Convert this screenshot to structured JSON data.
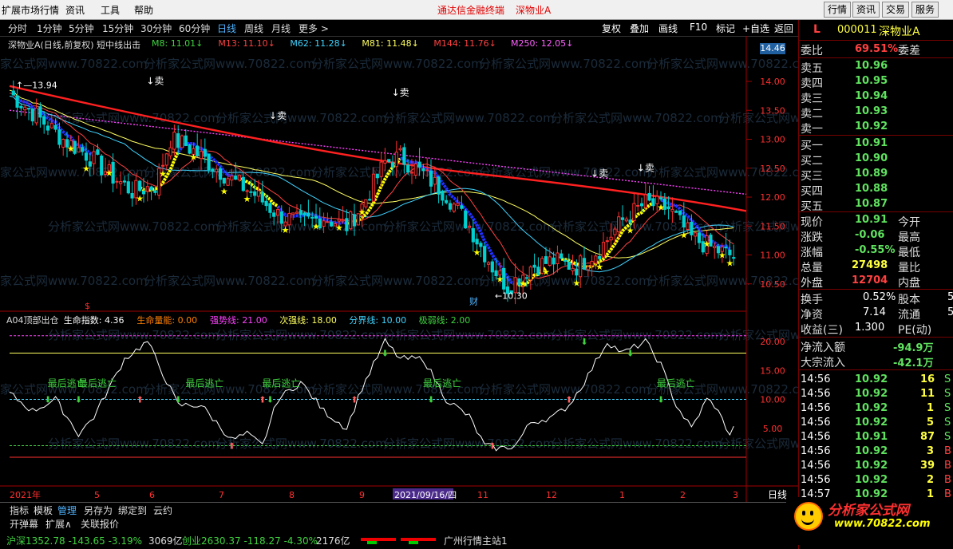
{
  "menubar": {
    "items": [
      "扩展市场行情",
      "资讯",
      "工具",
      "帮助"
    ],
    "ad": [
      "通达信金融终端",
      "深物业A"
    ],
    "right_buttons": [
      "行情",
      "资讯",
      "交易",
      "服务"
    ]
  },
  "toolbar": {
    "periods": [
      "分时",
      "1分钟",
      "5分钟",
      "15分钟",
      "30分钟",
      "60分钟",
      "日线",
      "周线",
      "月线",
      "更多 >"
    ],
    "active": "日线",
    "right_buttons": [
      "复权",
      "叠加",
      "画线",
      "F10",
      "标记",
      "+自选",
      "返回"
    ]
  },
  "chart_header": {
    "title": "深物业A(日线,前复权) 短中线出击",
    "mas": [
      {
        "label": "M8: 11.01",
        "color": "#3fd33f"
      },
      {
        "label": "M13: 11.10",
        "color": "#ff4040"
      },
      {
        "label": "M62: 11.28",
        "color": "#3fd3ff"
      },
      {
        "label": "M81: 11.48",
        "color": "#ffff60"
      },
      {
        "label": "M144: 11.76",
        "color": "#ff4040"
      },
      {
        "label": "M250: 12.05",
        "color": "#ff60ff"
      }
    ],
    "price_box": "14.46"
  },
  "price_axis": [
    "14.00",
    "13.50",
    "13.00",
    "12.50",
    "12.00",
    "11.50",
    "11.00",
    "10.50"
  ],
  "price_annotations": {
    "high": "13.94",
    "low": "10.30",
    "sell": "卖",
    "cai": "财"
  },
  "indicator_header": {
    "items": [
      {
        "label": "A04顶部出仓",
        "color": "#dddddd"
      },
      {
        "label": "生命指数: 4.36",
        "color": "#ffffff"
      },
      {
        "label": "生命量能: 0.00",
        "color": "#ff8000"
      },
      {
        "label": "强势线: 21.00",
        "color": "#ff40ff"
      },
      {
        "label": "次强线: 18.00",
        "color": "#ffff60"
      },
      {
        "label": "分界线: 10.00",
        "color": "#3fd3ff"
      },
      {
        "label": "极弱线: 2.00",
        "color": "#3fd33f"
      }
    ],
    "escape_label": "最后逃亡"
  },
  "indicator_axis": [
    "20.00",
    "15.00",
    "10.00",
    "5.00"
  ],
  "date_axis": {
    "labels": [
      "2021年",
      "5",
      "6",
      "7",
      "8",
      "9",
      "2021/09/16/四",
      "11",
      "12",
      "1",
      "2",
      "3"
    ],
    "period": "日线"
  },
  "tabbar": {
    "items": [
      "指标",
      "模板",
      "管理",
      "另存为",
      "绑定到",
      "云约"
    ],
    "row2": [
      "开弹幕",
      "扩展∧",
      "关联报价"
    ]
  },
  "status": {
    "sh": "沪深1352.78 -143.65 -3.19%",
    "sh_amt": "3069亿",
    "cy": "创业2630.37 -118.27 -4.30%",
    "cy_amt": "2176亿",
    "server": "广州行情主站1"
  },
  "quote": {
    "code_letter": "L",
    "code": "000011",
    "name": "深物业A",
    "weibi_label": "委比",
    "weibi": "69.51%",
    "weicha_label": "委差",
    "asks": [
      {
        "label": "卖五",
        "price": "10.96"
      },
      {
        "label": "卖四",
        "price": "10.95"
      },
      {
        "label": "卖三",
        "price": "10.94"
      },
      {
        "label": "卖二",
        "price": "10.93"
      },
      {
        "label": "卖一",
        "price": "10.92"
      }
    ],
    "bids": [
      {
        "label": "买一",
        "price": "10.91"
      },
      {
        "label": "买二",
        "price": "10.90"
      },
      {
        "label": "买三",
        "price": "10.89"
      },
      {
        "label": "买四",
        "price": "10.88"
      },
      {
        "label": "买五",
        "price": "10.87"
      }
    ],
    "stats": [
      {
        "l1": "现价",
        "v1": "10.91",
        "l2": "今开"
      },
      {
        "l1": "涨跌",
        "v1": "-0.06",
        "l2": "最高"
      },
      {
        "l1": "涨幅",
        "v1": "-0.55%",
        "l2": "最低"
      },
      {
        "l1": "总量",
        "v1": "27498",
        "l2": "量比"
      },
      {
        "l1": "外盘",
        "v1": "12704",
        "l2": "内盘"
      }
    ],
    "stats2": [
      {
        "l1": "换手",
        "v1": "0.52%",
        "l2": "股本",
        "v2": "5"
      },
      {
        "l1": "净资",
        "v1": "7.14",
        "l2": "流通",
        "v2": "5"
      },
      {
        "l1": "收益(三)",
        "v1": "1.300",
        "l2": "PE(动)",
        "v2": ""
      }
    ],
    "flows": [
      {
        "label": "净流入额",
        "value": "-94.9万"
      },
      {
        "label": "大宗流入",
        "value": "-42.1万"
      }
    ],
    "ticks": [
      {
        "time": "14:56",
        "price": "10.92",
        "vol": "16",
        "flag": "S"
      },
      {
        "time": "14:56",
        "price": "10.92",
        "vol": "11",
        "flag": "S"
      },
      {
        "time": "14:56",
        "price": "10.92",
        "vol": "1",
        "flag": "S"
      },
      {
        "time": "14:56",
        "price": "10.92",
        "vol": "5",
        "flag": "S"
      },
      {
        "time": "14:56",
        "price": "10.91",
        "vol": "87",
        "flag": "S"
      },
      {
        "time": "14:56",
        "price": "10.92",
        "vol": "3",
        "flag": "B"
      },
      {
        "time": "14:56",
        "price": "10.92",
        "vol": "39",
        "flag": "B"
      },
      {
        "time": "14:56",
        "price": "10.92",
        "vol": "2",
        "flag": "B"
      },
      {
        "time": "14:57",
        "price": "10.92",
        "vol": "1",
        "flag": "B"
      }
    ]
  },
  "logo": {
    "text": "分析家公式网",
    "url": "www.70822.com"
  },
  "colors": {
    "up": "#ff3030",
    "down": "#00d0d0",
    "yellow": "#ffff00",
    "blue": "#2030ff"
  }
}
